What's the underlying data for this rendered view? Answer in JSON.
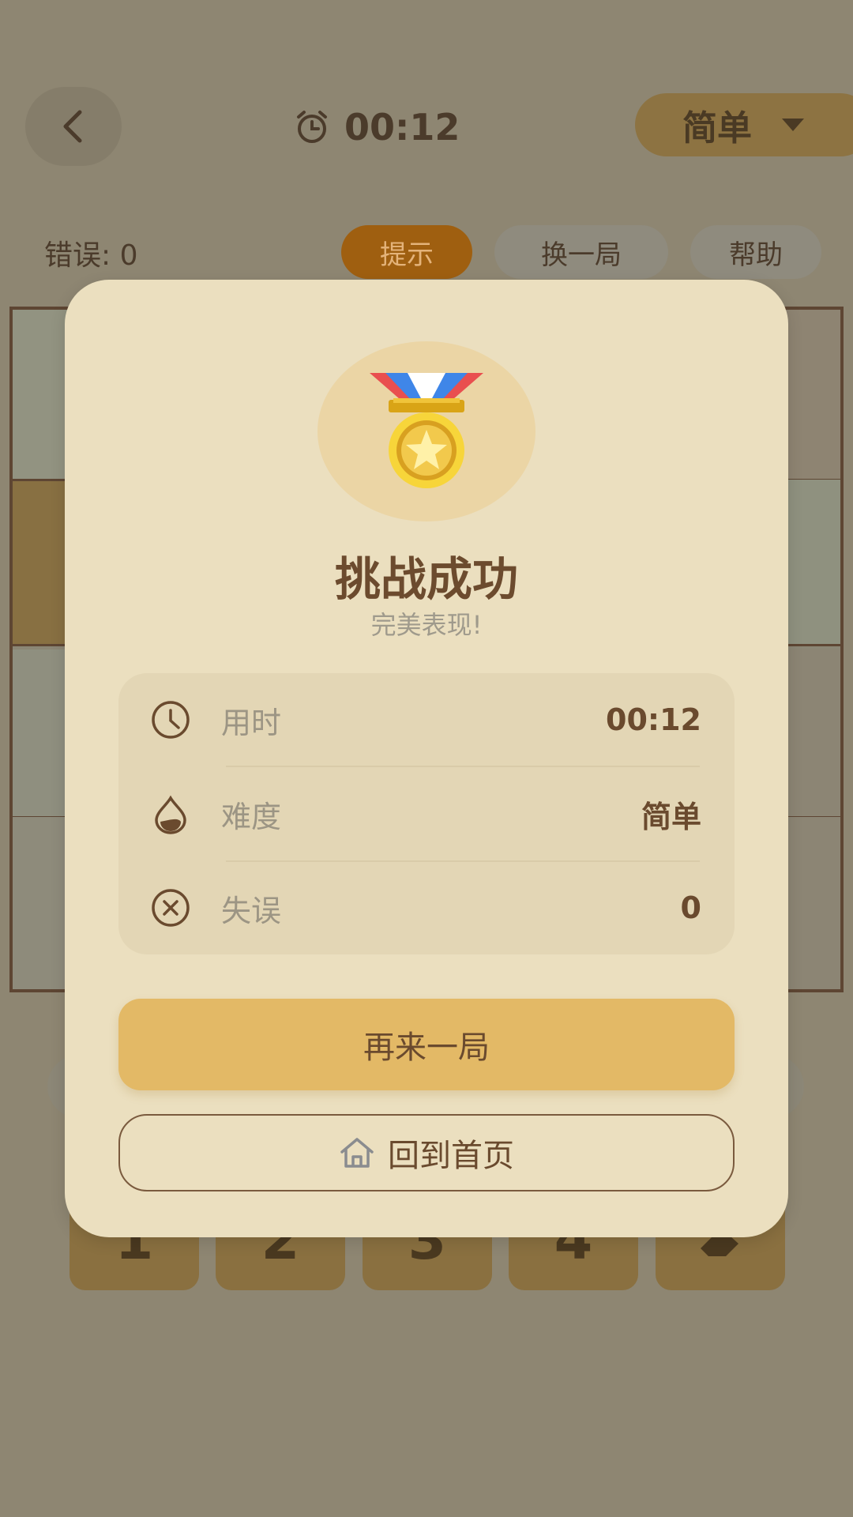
{
  "header": {
    "timer": "00:12",
    "difficulty": "简单"
  },
  "toolbar": {
    "errors_label": "错误: 0",
    "hint": "提示",
    "new_game": "换一局",
    "help": "帮助"
  },
  "keypad": [
    "1",
    "2",
    "3",
    "4"
  ],
  "dialog": {
    "title": "挑战成功",
    "subtitle": "完美表现!",
    "stats": [
      {
        "icon": "clock-icon",
        "label": "用时",
        "value": "00:12"
      },
      {
        "icon": "difficulty-icon",
        "label": "难度",
        "value": "简单"
      },
      {
        "icon": "close-circle-icon",
        "label": "失误",
        "value": "0"
      }
    ],
    "play_again": "再来一局",
    "home": "回到首页"
  },
  "colors": {
    "accent": "#e3b966",
    "brown": "#6a4a2e",
    "dialog_bg": "#ebdfbf"
  }
}
